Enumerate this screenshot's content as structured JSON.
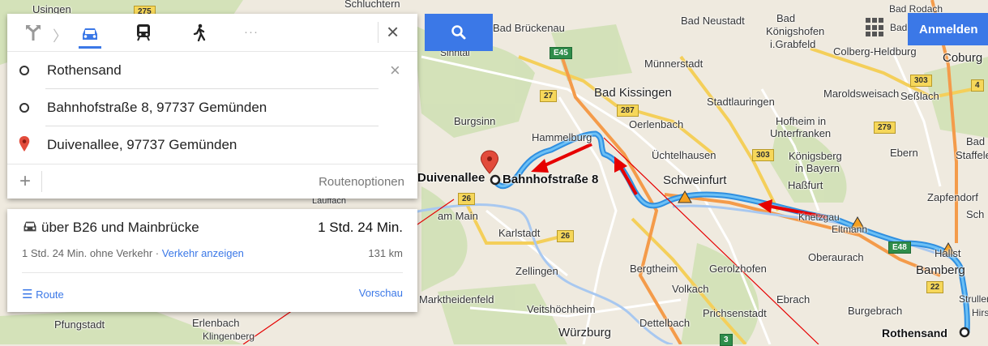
{
  "colors": {
    "route": "#3ea1ea",
    "accent": "#3b78e7",
    "annotation": "#e60000"
  },
  "directions": {
    "modes": [
      "best-route-icon",
      "car-icon",
      "transit-icon",
      "walking-icon"
    ],
    "more": "···",
    "origin": "Rothensand",
    "waypoint": "Bahnhofstraße 8, 97737 Gemünden",
    "destination": "Duivenallee, 97737 Gemünden",
    "route_options": "Routenoptionen"
  },
  "result": {
    "via": "über B26 und Mainbrücke",
    "duration": "1 Std. 24 Min.",
    "traffic_text": "1 Std. 24 Min. ohne Verkehr · ",
    "traffic_link": "Verkehr anzeigen",
    "distance": "131 km",
    "route_label": "Route",
    "preview_label": "Vorschau"
  },
  "header": {
    "signin": "Anmelden"
  },
  "map": {
    "towns": [
      "Usingen",
      "Schluchtern",
      "Bad Brückenau",
      "Sinntal",
      "Bad Neustadt",
      "Bad",
      "Königshofen",
      "i.Grabfeld",
      "Bad Rodach",
      "Bad",
      "Colberg-Heldburg",
      "Coburg",
      "Münnerstadt",
      "Bad Kissingen",
      "Stadtlauringen",
      "Maroldsweisach",
      "Seßlach",
      "Burgsinn",
      "Oerlenbach",
      "Hofheim in",
      "Unterfranken",
      "Ebern",
      "Bad",
      "Staffele",
      "Hammelburg",
      "Üchtelhausen",
      "Königsberg",
      "in Bayern",
      "Schweinfurt",
      "Haßfurt",
      "Zapfendorf",
      "Sch",
      "Lauffach",
      "am Main",
      "Knetzgau",
      "Eltmann",
      "Karlstadt",
      "Oberaurach",
      "Hallst",
      "Bamberg",
      "Zellingen",
      "Bergtheim",
      "Gerolzhofen",
      "Strullendo",
      "Marktheidenfeld",
      "Volkach",
      "Ebrach",
      "Hirsch",
      "Veitshöchheim",
      "Prichsenstadt",
      "Burgebrach",
      "Pfungstadt",
      "Erlenbach",
      "Klingenberg",
      "Würzburg",
      "Dettelbach"
    ],
    "highlighted": [
      "Duivenallee",
      "Bahnhofstraße 8",
      "Rothensand"
    ],
    "road_shields": [
      "275",
      "E45",
      "27",
      "287",
      "303",
      "279",
      "303",
      "4",
      "26",
      "26",
      "E48",
      "22",
      "3"
    ]
  }
}
